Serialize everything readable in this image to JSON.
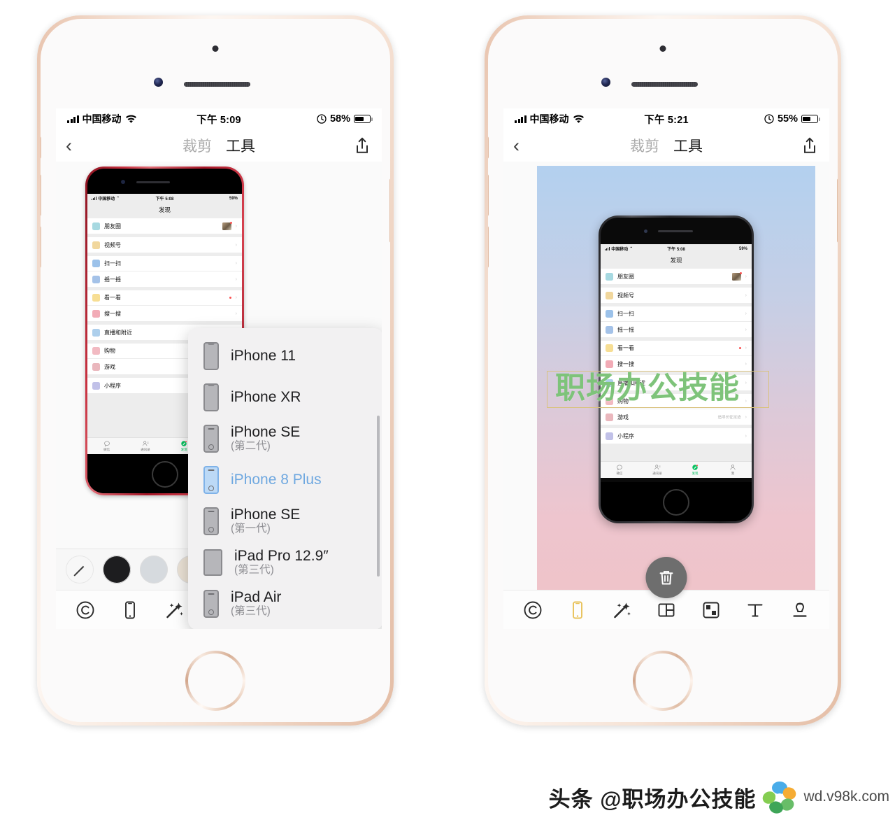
{
  "app": {
    "nav": {
      "back_icon": "chevron-left-icon",
      "tab_crop": "裁剪",
      "tab_tools": "工具",
      "share_icon": "share-icon"
    }
  },
  "left_phone": {
    "status_bar": {
      "carrier": "中国移动",
      "wifi_icon": "wifi-icon",
      "time": "下午 5:09",
      "lock_icon": "rotation-lock-icon",
      "battery_percent": "58%",
      "battery_level": 58
    },
    "colors": {
      "swatches": [
        {
          "name": "none",
          "hex": "#f7f7f7",
          "selected": false
        },
        {
          "name": "black",
          "hex": "#1d1d1f",
          "selected": false
        },
        {
          "name": "silver",
          "hex": "#d6dade",
          "selected": false
        },
        {
          "name": "beige",
          "hex": "#e9e0d4",
          "selected": false
        },
        {
          "name": "dark-red",
          "hex": "#7d1616",
          "selected": true
        }
      ],
      "device_icon": "device-frame-icon",
      "palette_icon": "palette-icon"
    },
    "toolbar": [
      {
        "name": "watermark-tool",
        "icon": "copyright-icon",
        "active": false
      },
      {
        "name": "device-frame-tool",
        "icon": "phone-icon",
        "active": false
      },
      {
        "name": "magic-tool",
        "icon": "magic-wand-icon",
        "active": false
      },
      {
        "name": "layout-tool",
        "icon": "layout-icon",
        "active": false
      },
      {
        "name": "mosaic-tool",
        "icon": "checkerboard-icon",
        "active": false
      },
      {
        "name": "text-tool",
        "icon": "text-icon",
        "active": false
      },
      {
        "name": "stamp-tool",
        "icon": "stamp-icon",
        "active": false
      }
    ]
  },
  "right_phone": {
    "status_bar": {
      "carrier": "中国移动",
      "wifi_icon": "wifi-icon",
      "time": "下午 5:21",
      "lock_icon": "rotation-lock-icon",
      "battery_percent": "55%",
      "battery_level": 55
    },
    "photo": {
      "gradient_top": "#b3d0ef",
      "gradient_bottom": "#efc4c9",
      "watermark_text": "职场办公技能",
      "watermark_color": "#7ec37a",
      "watermark_border_color": "#d9c27e"
    },
    "delete_button": {
      "icon": "trash-icon",
      "label": ""
    },
    "toolbar": [
      {
        "name": "watermark-tool",
        "icon": "copyright-icon",
        "active": false
      },
      {
        "name": "device-frame-tool",
        "icon": "phone-icon",
        "active": true
      },
      {
        "name": "magic-tool",
        "icon": "magic-wand-icon",
        "active": false
      },
      {
        "name": "layout-tool",
        "icon": "layout-icon",
        "active": false
      },
      {
        "name": "mosaic-tool",
        "icon": "checkerboard-icon",
        "active": false
      },
      {
        "name": "text-tool",
        "icon": "text-icon",
        "active": false
      },
      {
        "name": "stamp-tool",
        "icon": "stamp-icon",
        "active": false
      }
    ],
    "active_tool_color": "#e8c25a"
  },
  "device_popover": {
    "items": [
      {
        "name": "iPhone 11",
        "sub": "",
        "style": "notch",
        "selected": false
      },
      {
        "name": "iPhone XR",
        "sub": "",
        "style": "notch",
        "selected": false
      },
      {
        "name": "iPhone SE",
        "sub": "(第二代)",
        "style": "home",
        "selected": false
      },
      {
        "name": "iPhone 8 Plus",
        "sub": "",
        "style": "home",
        "selected": true
      },
      {
        "name": "iPhone SE",
        "sub": "(第一代)",
        "style": "home",
        "selected": false
      },
      {
        "name": "iPad Pro 12.9″",
        "sub": "(第三代)",
        "style": "pad",
        "selected": false
      },
      {
        "name": "iPad Air",
        "sub": "(第三代)",
        "style": "home",
        "selected": false
      }
    ],
    "selected_color": "#6fa8e0"
  },
  "wechat": {
    "status_bar": {
      "carrier": "中国移动",
      "time": "下午 5:08",
      "battery_percent": "59%"
    },
    "title": "发现",
    "groups": [
      [
        {
          "label": "朋友圈",
          "icon": "moments-icon",
          "color": "#5fb9c9",
          "thumb": true,
          "dot": false,
          "extra": ""
        }
      ],
      [
        {
          "label": "视频号",
          "icon": "channels-icon",
          "color": "#e6b64c",
          "thumb": false,
          "dot": false,
          "extra": ""
        }
      ],
      [
        {
          "label": "扫一扫",
          "icon": "scan-icon",
          "color": "#4a90d9",
          "thumb": false,
          "dot": false,
          "extra": ""
        },
        {
          "label": "摇一摇",
          "icon": "shake-icon",
          "color": "#5a8fd6",
          "thumb": false,
          "dot": false,
          "extra": ""
        }
      ],
      [
        {
          "label": "看一看",
          "icon": "topstories-icon",
          "color": "#f0c33c",
          "thumb": false,
          "dot": true,
          "extra": ""
        },
        {
          "label": "搜一搜",
          "icon": "search-icon",
          "color": "#e8667a",
          "thumb": false,
          "dot": false,
          "extra": ""
        }
      ],
      [
        {
          "label": "直播和附近",
          "icon": "live-nearby-icon",
          "color": "#6aa8dd",
          "thumb": false,
          "dot": false,
          "extra": ""
        }
      ],
      [
        {
          "label": "购物",
          "icon": "shopping-icon",
          "color": "#e8828f",
          "thumb": false,
          "dot": false,
          "extra": ""
        },
        {
          "label": "游戏",
          "icon": "games-icon",
          "color": "#d97b86",
          "thumb": false,
          "dot": false,
          "extra": "追寻长征足迹"
        }
      ],
      [
        {
          "label": "小程序",
          "icon": "miniprogram-icon",
          "color": "#8e8ed6",
          "thumb": false,
          "dot": false,
          "extra": ""
        }
      ]
    ],
    "tabs": [
      {
        "label": "微信",
        "icon": "chat-icon",
        "active": false
      },
      {
        "label": "通讯录",
        "icon": "contacts-icon",
        "active": false
      },
      {
        "label": "发现",
        "icon": "discover-icon",
        "active": true
      },
      {
        "label": "我",
        "icon": "me-icon",
        "active": false
      }
    ]
  },
  "credit": {
    "headline": "头条 @职场办公技能",
    "site": "wd.v98k.com",
    "logo_icon": "flower-logo-icon"
  }
}
